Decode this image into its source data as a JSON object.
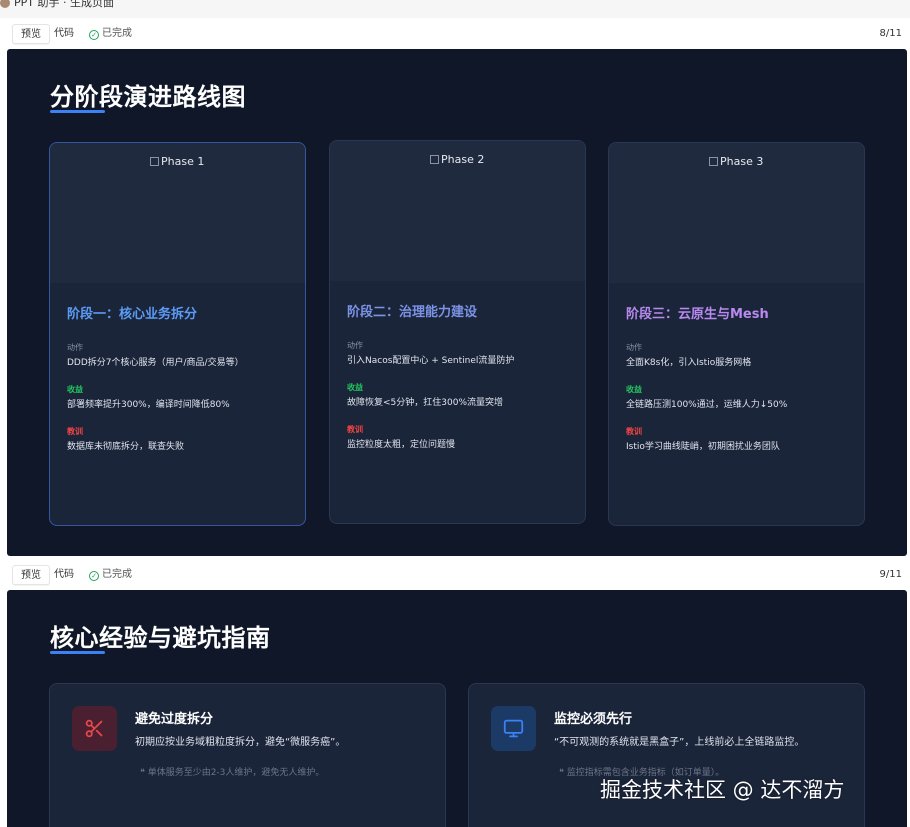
{
  "topbar": {
    "crumb": "PPT 助手 · 生成页面"
  },
  "slide1": {
    "toolbar": {
      "tab_preview": "预览",
      "tab_code": "代码",
      "status": "已完成",
      "page": "8/11"
    },
    "title": "分阶段演进路线图",
    "phases": [
      {
        "img_alt": "Phase 1",
        "title": "阶段一：核心业务拆分",
        "title_color": "#5b9bf5",
        "action_label": "动作",
        "action": "DDD拆分7个核心服务（用户/商品/交易等）",
        "gain_label": "收益",
        "gain": "部署频率提升300%，编译时间降低80%",
        "lesson_label": "教训",
        "lesson": "数据库未彻底拆分，联查失败"
      },
      {
        "img_alt": "Phase 2",
        "title": "阶段二：治理能力建设",
        "title_color": "#7b93e6",
        "action_label": "动作",
        "action": "引入Nacos配置中心 + Sentinel流量防护",
        "gain_label": "收益",
        "gain": "故障恢复<5分钟，扛住300%流量突增",
        "lesson_label": "教训",
        "lesson": "监控粒度太粗，定位问题慢"
      },
      {
        "img_alt": "Phase 3",
        "title": "阶段三：云原生与Mesh",
        "title_color": "#b889ef",
        "action_label": "动作",
        "action": "全面K8s化，引入Istio服务网格",
        "gain_label": "收益",
        "gain": "全链路压测100%通过，运维人力↓50%",
        "lesson_label": "教训",
        "lesson": "Istio学习曲线陡峭，初期困扰业务团队"
      }
    ]
  },
  "slide2": {
    "toolbar": {
      "tab_preview": "预览",
      "tab_code": "代码",
      "status": "已完成",
      "page": "9/11"
    },
    "title": "核心经验与避坑指南",
    "cards": [
      {
        "icon": "scissors-icon",
        "icon_color": "#e5484d",
        "title": "避免过度拆分",
        "desc": "初期应按业务域粗粒度拆分，避免“微服务癌”。",
        "quote": "❝  单体服务至少由2-3人维护，避免无人维护。"
      },
      {
        "icon": "monitor-icon",
        "icon_color": "#3b82f6",
        "title": "监控必须先行",
        "desc": "“不可观测的系统就是黑盒子”，上线前必上全链路监控。",
        "quote": "❝  监控指标需包含业务指标（如订单量）。"
      }
    ]
  },
  "watermark": "掘金技术社区 @ 达不溜方"
}
